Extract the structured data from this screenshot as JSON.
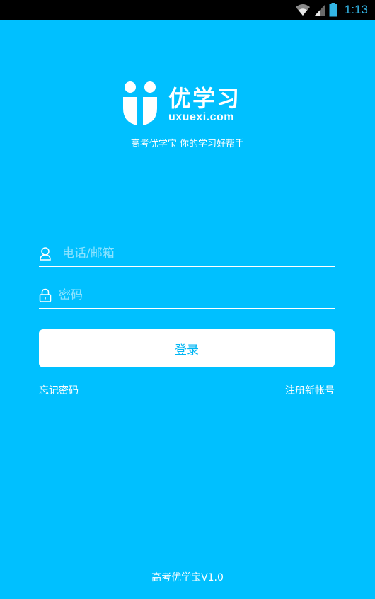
{
  "status_bar": {
    "time": "1:13"
  },
  "logo": {
    "cn": "优学习",
    "en": "uxuexi.com"
  },
  "slogan": "高考优学宝 你的学习好帮手",
  "form": {
    "phone_placeholder": "电话/邮箱",
    "password_placeholder": "密码",
    "login_label": "登录",
    "forgot_label": "忘记密码",
    "register_label": "注册新帐号"
  },
  "footer": {
    "version": "高考优学宝V1.0"
  },
  "colors": {
    "background": "#00c0ff",
    "button_text": "#00b6f3",
    "status_accent": "#33b5e5"
  }
}
